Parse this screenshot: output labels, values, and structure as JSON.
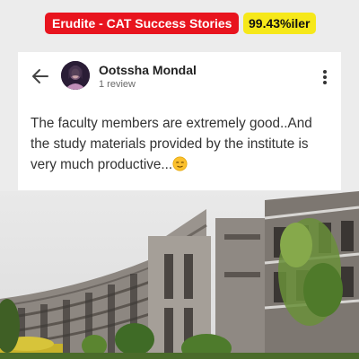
{
  "header": {
    "title_badge": "Erudite - CAT Success Stories",
    "score_badge": "99.43%iler",
    "colors": {
      "title_badge_bg": "#e8141e",
      "score_badge_bg": "#f6e81a"
    }
  },
  "review": {
    "back_icon": "arrow-left-icon",
    "reviewer_name": "Ootssha Mondal",
    "review_count": "1 review",
    "more_icon": "more-vertical-icon",
    "text": "The faculty members are extremely good..And the study materials provided by the institute is very much productive...",
    "emoji_icon": "relieved-face-emoji"
  },
  "background": {
    "image": "campus-building-photo"
  }
}
